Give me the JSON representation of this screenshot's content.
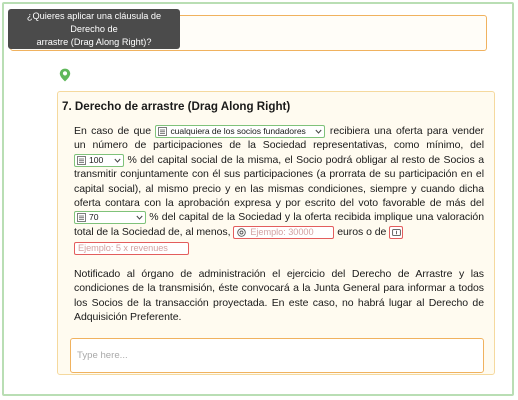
{
  "question": {
    "tooltip_line1": "¿Quieres aplicar una cláusula de Derecho de",
    "tooltip_line2": "arrastre (Drag Along Right)?"
  },
  "clause": {
    "title": "7. Derecho de arrastre (Drag Along Right)",
    "p1_a": "En caso de que ",
    "p1_b": " recibiera una oferta para vender un número de participaciones de la Sociedad representativas, como mínimo, del ",
    "p1_c": " % del capital social de la misma, el Socio podrá obligar al resto de Socios a transmitir conjuntamente con él sus participaciones (a prorrata de su participación en el capital social), al mismo precio y en las mismas condiciones, siempre y cuando dicha oferta contara con la aprobación expresa y por escrito del voto favorable de más del ",
    "p1_d": " % del capital de la Sociedad y la oferta recibida implique una valoración total de la Sociedad de, al menos, ",
    "p1_e": " euros o de ",
    "p1_f": "",
    "p2": "Notificado al órgano de administración el ejercicio del Derecho de Arrastre y las condiciones de la transmisión, éste convocará a la Junta General para informar a todos los Socios de la transacción proyectada. En este caso, no habrá lugar al Derecho de Adquisición Preferente.",
    "select_partner": "cualquiera de los socios fundadores",
    "select_pct_offer": "100",
    "select_pct_vote": "70",
    "valuation_placeholder": "Ejemplo: 30000",
    "multiple_placeholder": "Ejemplo: 5 x revenues"
  },
  "notes": {
    "placeholder": "Type here..."
  },
  "colors": {
    "frame_border": "#b9deb4",
    "orange_accent": "#f0b25f",
    "card_background": "#fffbf0",
    "select_border": "#7fc27a",
    "input_border_error": "#e35d5d",
    "tooltip_background": "#4b4b4b",
    "hint_icon": "#5fb85a"
  }
}
